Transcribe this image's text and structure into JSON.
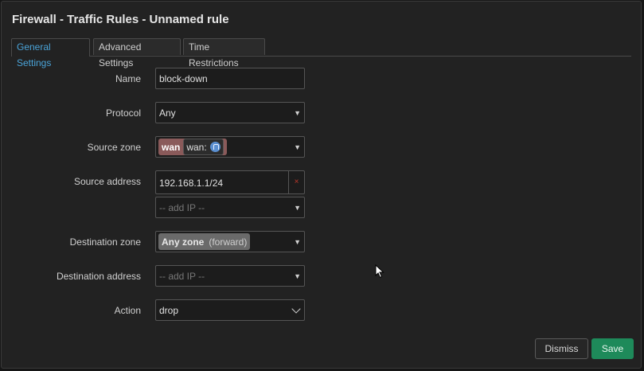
{
  "dialog": {
    "title": "Firewall - Traffic Rules - Unnamed rule"
  },
  "tabs": [
    {
      "label": "General Settings",
      "active": true
    },
    {
      "label": "Advanced Settings",
      "active": false
    },
    {
      "label": "Time Restrictions",
      "active": false
    }
  ],
  "form": {
    "name": {
      "label": "Name",
      "value": "block-down"
    },
    "protocol": {
      "label": "Protocol",
      "value": "Any"
    },
    "source_zone": {
      "label": "Source zone",
      "zone": "wan",
      "network": "wan:",
      "network_icon": "network-icon"
    },
    "source_address": {
      "label": "Source address",
      "value": "192.168.1.1/24",
      "remove_symbol": "×",
      "add_placeholder": "-- add IP --"
    },
    "destination_zone": {
      "label": "Destination zone",
      "zone": "Any zone",
      "suffix": "(forward)"
    },
    "destination_address": {
      "label": "Destination address",
      "add_placeholder": "-- add IP --"
    },
    "action": {
      "label": "Action",
      "value": "drop"
    }
  },
  "buttons": {
    "dismiss": "Dismiss",
    "save": "Save"
  },
  "colors": {
    "background": "#222222",
    "active_tab": "#4aa3d8",
    "wan_zone": "#8a5a5a",
    "save": "#1e8a5a",
    "remove": "#c0392b"
  }
}
